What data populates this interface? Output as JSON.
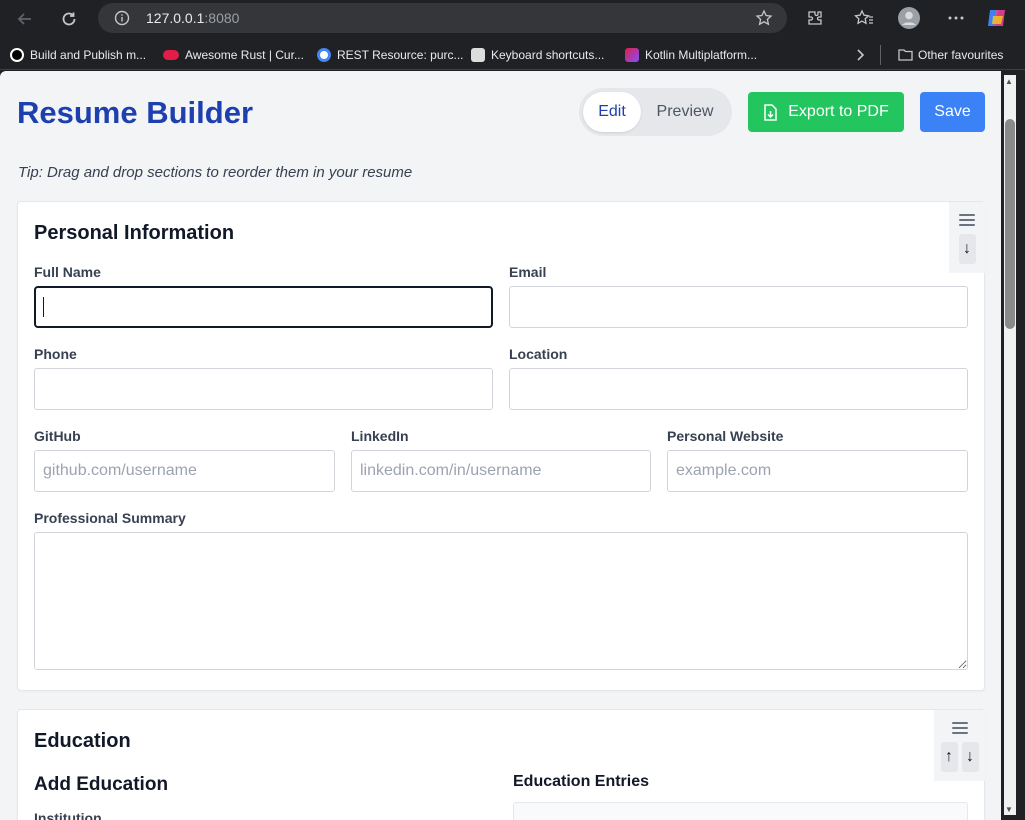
{
  "browser": {
    "url_host": "127.0.0.1",
    "url_port": ":8080",
    "bookmarks": [
      {
        "label": "Build and Publish m...",
        "color": "#000000"
      },
      {
        "label": "Awesome Rust | Cur...",
        "color": "#e11d48"
      },
      {
        "label": "REST Resource: purc...",
        "color": "#4285f4"
      },
      {
        "label": "Keyboard shortcuts...",
        "color": "#dddddd"
      },
      {
        "label": "Kotlin Multiplatform...",
        "color": "#7f52ff"
      }
    ],
    "other_favourites": "Other favourites"
  },
  "header": {
    "title": "Resume Builder",
    "mode_edit": "Edit",
    "mode_preview": "Preview",
    "export_label": "Export to PDF",
    "save_label": "Save"
  },
  "tip": "Tip: Drag and drop sections to reorder them in your resume",
  "personal": {
    "title": "Personal Information",
    "full_name_label": "Full Name",
    "full_name_value": "",
    "email_label": "Email",
    "phone_label": "Phone",
    "location_label": "Location",
    "github_label": "GitHub",
    "github_placeholder": "github.com/username",
    "linkedin_label": "LinkedIn",
    "linkedin_placeholder": "linkedin.com/in/username",
    "website_label": "Personal Website",
    "website_placeholder": "example.com",
    "summary_label": "Professional Summary",
    "move_down": "↓"
  },
  "education": {
    "title": "Education",
    "add_title": "Add Education",
    "entries_title": "Education Entries",
    "institution_label": "Institution",
    "move_up": "↑",
    "move_down": "↓"
  },
  "colors": {
    "accent": "#1e40af",
    "export": "#22c55e",
    "save": "#3b82f6"
  }
}
